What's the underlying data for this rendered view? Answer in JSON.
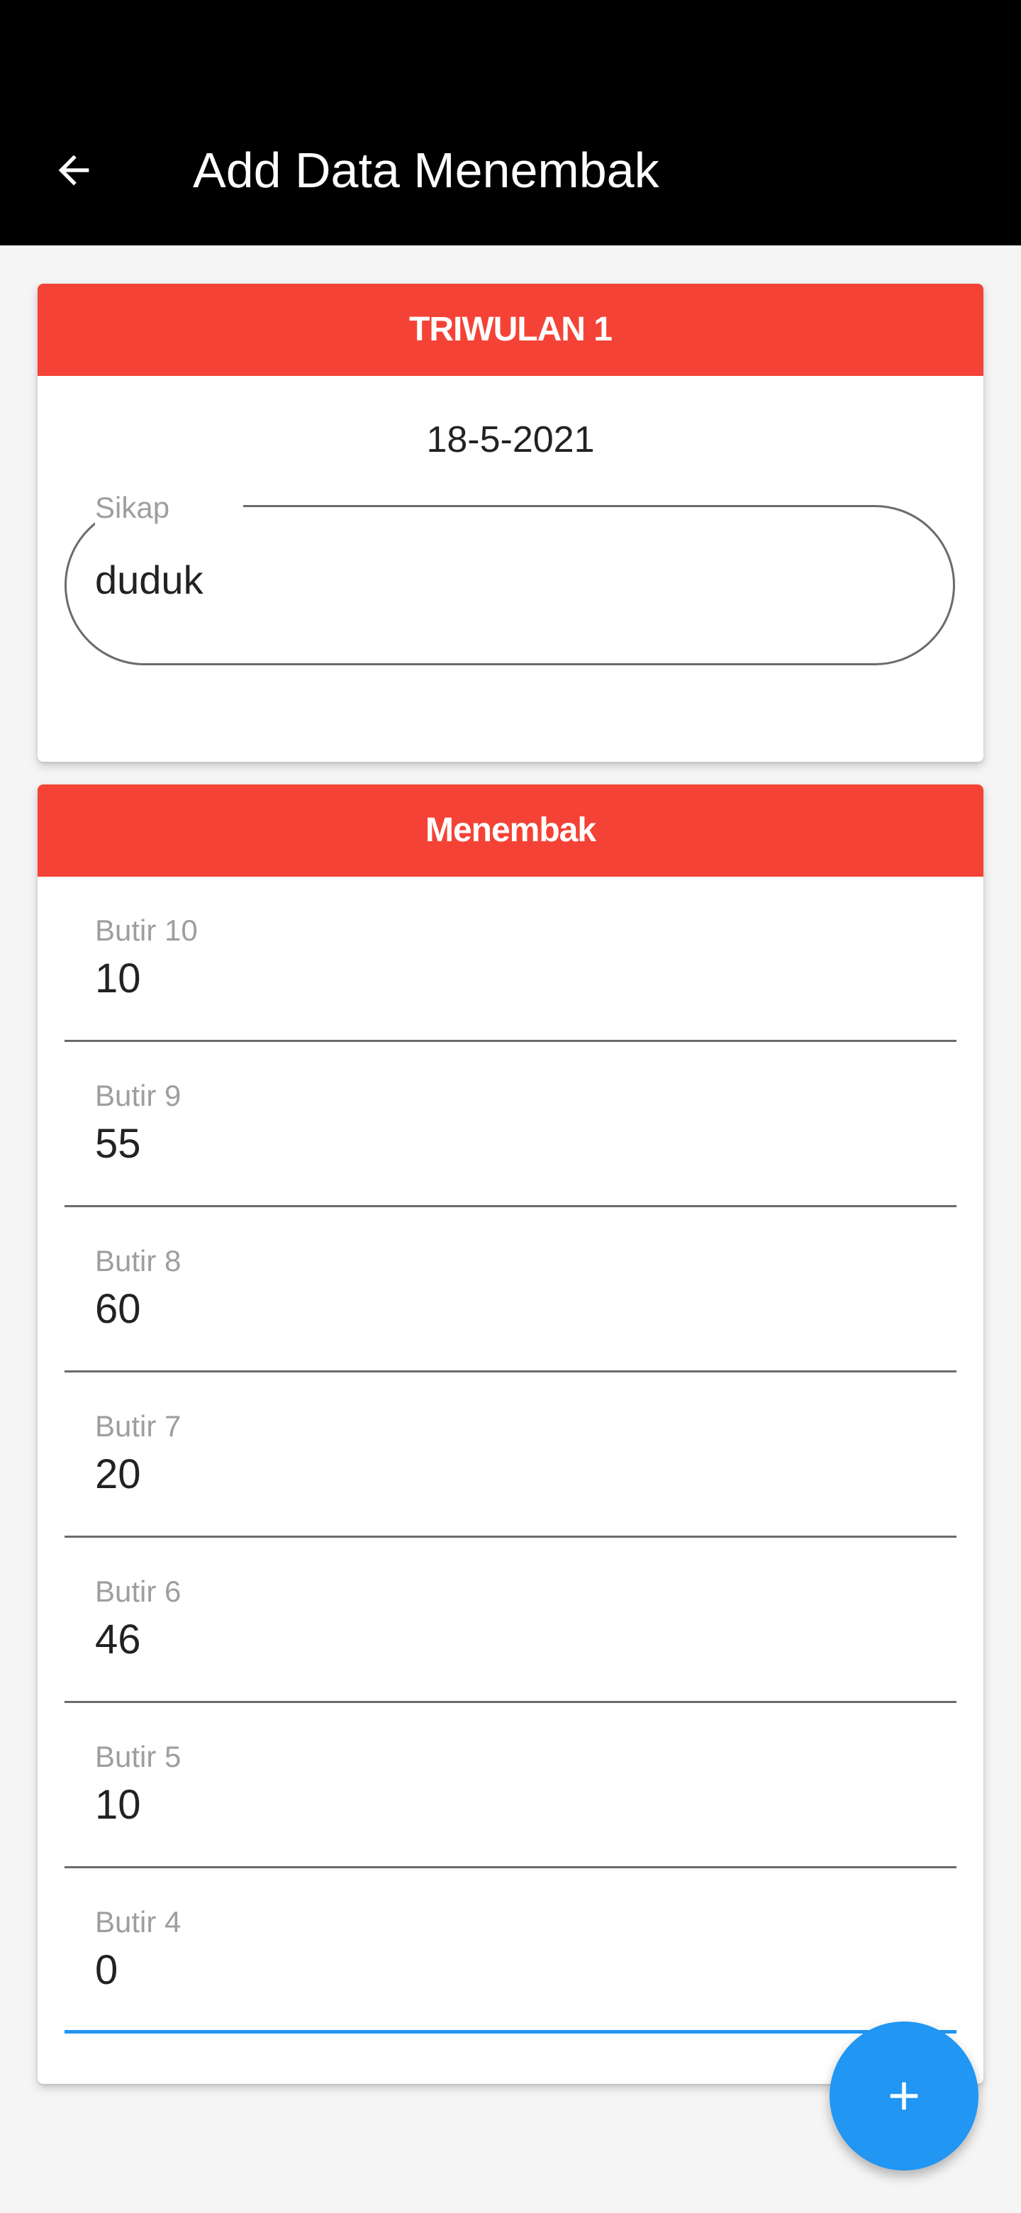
{
  "appbar": {
    "title": "Add Data Menembak",
    "back_icon": "arrow-back-icon",
    "background": "#000000"
  },
  "triwulan_card": {
    "header": "TRIWULAN 1",
    "date": "18-5-2021",
    "sikap_label": "Sikap",
    "sikap_value": "duduk"
  },
  "menembak_card": {
    "header": "Menembak",
    "fields": [
      {
        "label": "Butir 10",
        "value": "10"
      },
      {
        "label": "Butir 9",
        "value": "55"
      },
      {
        "label": "Butir 8",
        "value": "60"
      },
      {
        "label": "Butir 7",
        "value": "20"
      },
      {
        "label": "Butir 6",
        "value": "46"
      },
      {
        "label": "Butir 5",
        "value": "10"
      },
      {
        "label": "Butir 4",
        "value": "0"
      }
    ]
  },
  "fab": {
    "icon": "plus-icon"
  },
  "colors": {
    "header_red": "#f44336",
    "accent_blue": "#2196f3",
    "page_bg": "#f5f5f5"
  }
}
